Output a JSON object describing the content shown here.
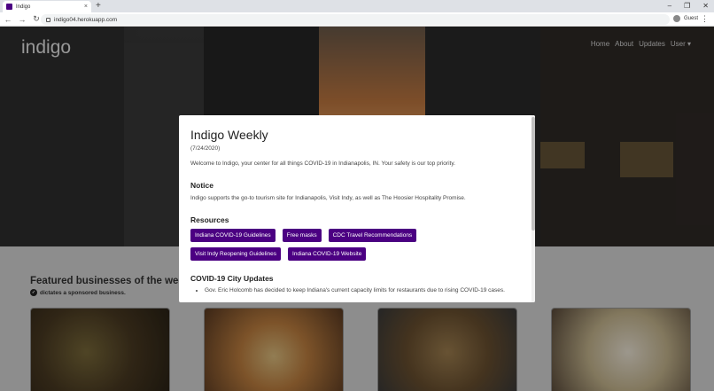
{
  "browser": {
    "tab_title": "Indigo",
    "tab_close": "×",
    "new_tab": "+",
    "url": "indigo04.herokuapp.com",
    "profile": "Guest",
    "window_controls": [
      "–",
      "❐",
      "✕"
    ]
  },
  "site": {
    "brand": "indigo",
    "nav": [
      "Home",
      "About",
      "Updates",
      "User ▾"
    ]
  },
  "modal": {
    "title": "Indigo Weekly",
    "date": "(7/24/2020)",
    "intro": "Welcome to Indigo, your center for all things COVID-19 in Indianapolis, IN. Your safety is our top priority.",
    "notice_heading": "Notice",
    "notice_text": "Indigo supports the go-to tourism site for Indianapolis, Visit Indy, as well as The Hoosier Hospitality Promise.",
    "resources_heading": "Resources",
    "resources": [
      "Indiana COVID-19 Guidelines",
      "Free masks",
      "CDC Travel Recommendations",
      "Visit Indy Reopening Guidelines",
      "Indiana COVID-19 Website"
    ],
    "updates_heading": "COVID-19 City Updates",
    "updates": [
      "Gov. Eric Holcomb has decided to keep Indiana's current capacity limits for restaurants due to rising COVID-19 cases."
    ]
  },
  "featured": {
    "title": "Featured businesses of the week...",
    "sponsor_text": "dictates a sponsored business."
  },
  "colors": {
    "accent": "#4b0082"
  }
}
